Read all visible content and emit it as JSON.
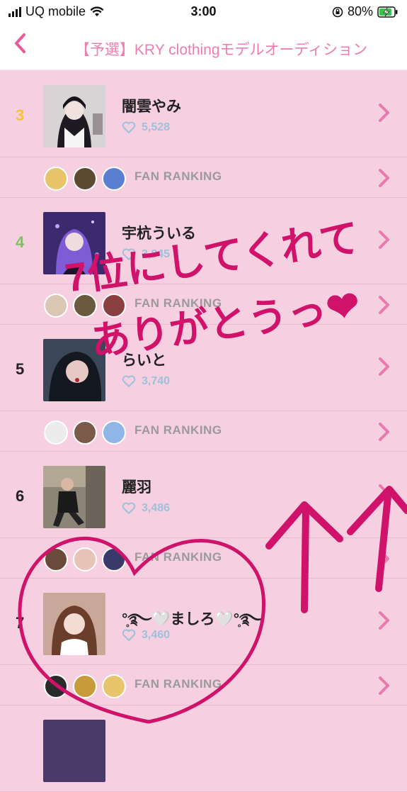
{
  "status_bar": {
    "carrier": "UQ mobile",
    "time": "3:00",
    "battery": "80%"
  },
  "header": {
    "back_icon": "chevron-left-icon",
    "title": "【予選】KRY clothingモデルオーディション"
  },
  "entries": [
    {
      "rank": "3",
      "rank_color": "#f5c23c",
      "name": "闇雲やみ",
      "likes": "5,528",
      "fan_label": "FAN RANKING"
    },
    {
      "rank": "4",
      "rank_color": "#7bc45b",
      "name": "宇杭ういる",
      "likes": "3,845",
      "fan_label": "FAN RANKING"
    },
    {
      "rank": "5",
      "rank_color": "#222222",
      "name": "らいと",
      "likes": "3,740",
      "fan_label": "FAN RANKING"
    },
    {
      "rank": "6",
      "rank_color": "#222222",
      "name": "麗羽",
      "likes": "3,486",
      "fan_label": "FAN RANKING"
    },
    {
      "rank": "7",
      "rank_color": "#222222",
      "name": "°̥࿐🤍ましろ🤍°̥࿐",
      "likes": "3,460",
      "fan_label": "FAN RANKING"
    }
  ],
  "annotation": {
    "line1": "7位にしてくれて",
    "line2": "ありがとうっ❤",
    "color": "#d0126a"
  },
  "colors": {
    "background": "#f6d0e0",
    "accent": "#e85a9b",
    "likes": "#9ec0dc"
  }
}
